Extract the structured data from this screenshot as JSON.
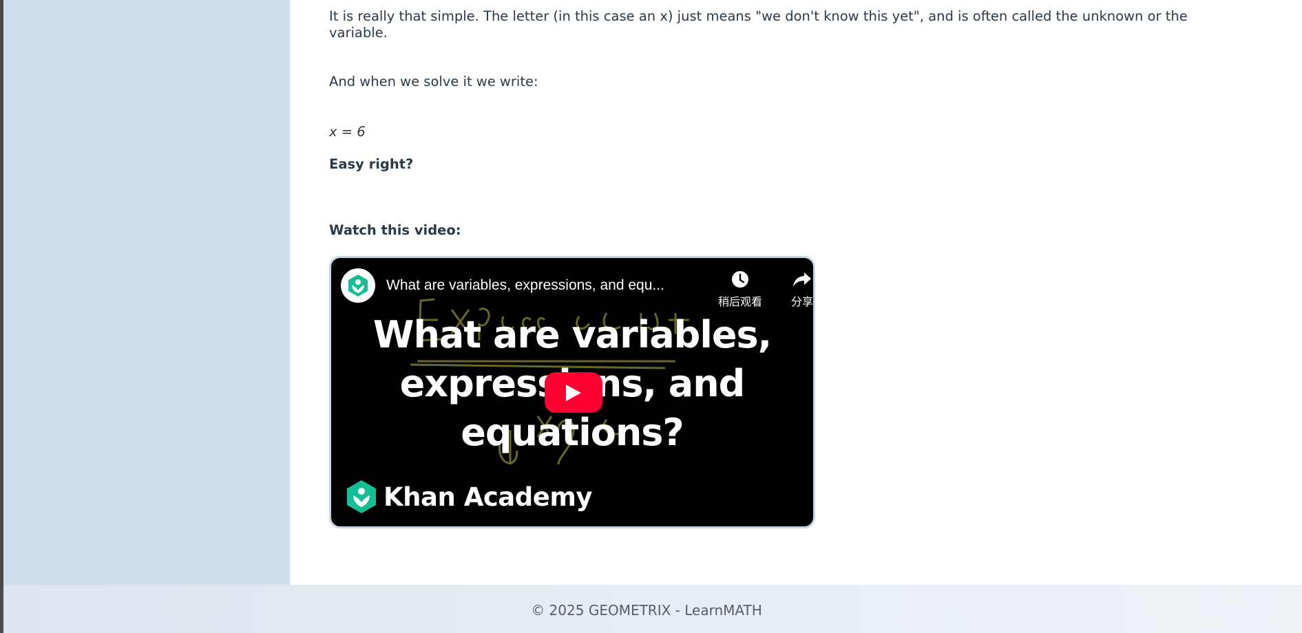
{
  "article": {
    "p1": "It is really that simple. The letter (in this case an x) just means \"we don't know this yet\", and is often called the unknown or the variable.",
    "p2": "And when we solve it we write:",
    "equation": "x = 6",
    "emphasis": "Easy right?",
    "watch_heading": "Watch this video:"
  },
  "video": {
    "title": "What are variables, expressions, and equ...",
    "watch_later_label": "稍后观看",
    "share_label": "分享",
    "thumbnail_title_lines": [
      "What are variables,",
      "expressions, and",
      "equations?"
    ],
    "brand": "Khan Academy",
    "play_color": "#ff0033",
    "brand_color": "#14bf96"
  },
  "footer": {
    "copyright": "© 2025 GEOMETRIX - LearnMATH"
  },
  "colors": {
    "sidebar": "#cfdfec",
    "text": "#2b3a4a"
  }
}
